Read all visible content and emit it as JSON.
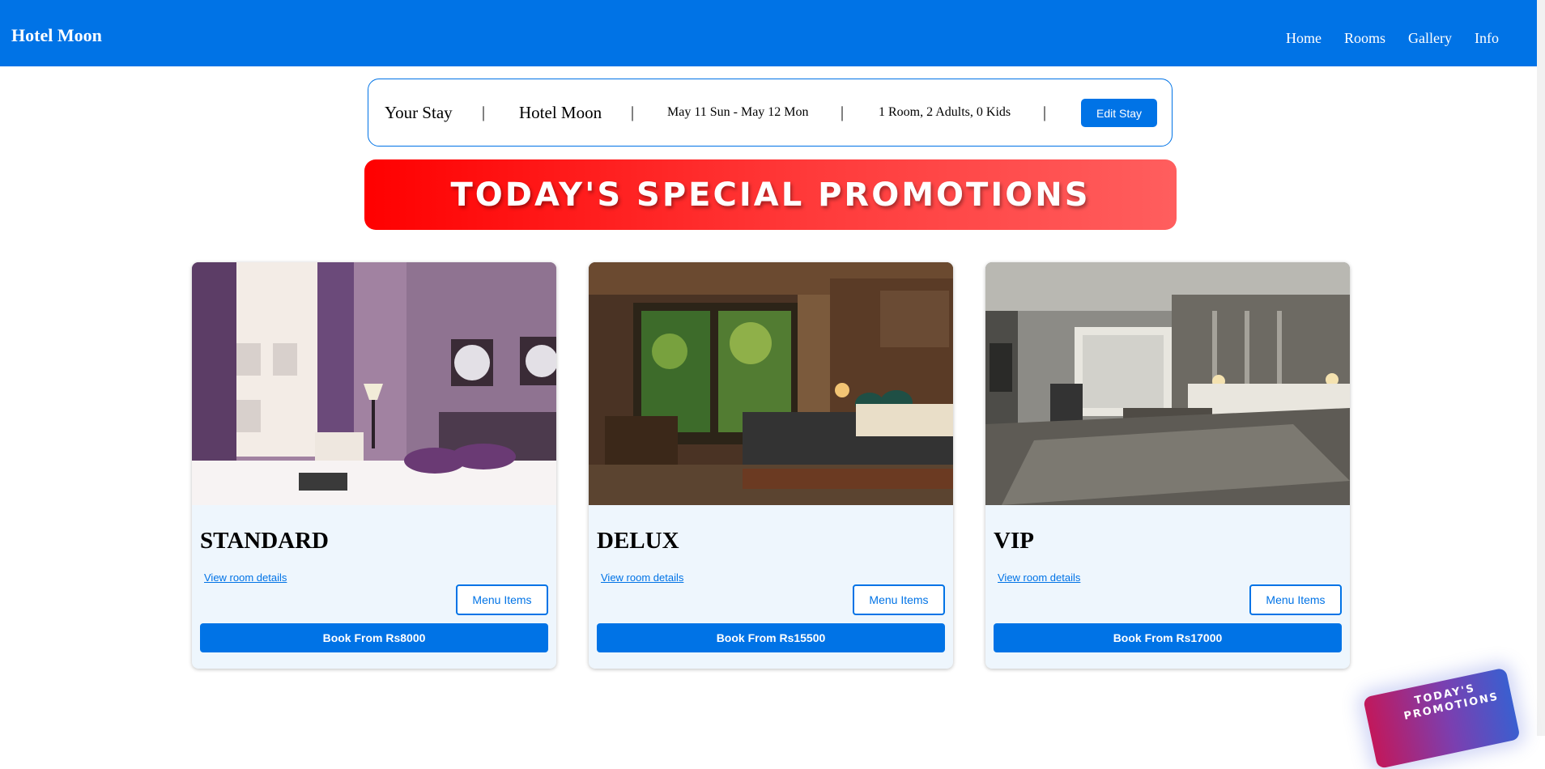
{
  "navbar": {
    "brand": "Hotel Moon",
    "links": [
      "Home",
      "Rooms",
      "Gallery",
      "Info"
    ]
  },
  "stay": {
    "title": "Your Stay",
    "separator": "|",
    "hotel": "Hotel Moon",
    "dates": "May 11 Sun - May 12 Mon",
    "guests": "1 Room, 2 Adults, 0 Kids",
    "edit_label": "Edit Stay"
  },
  "promo": {
    "banner_text": "TODAY'S SPECIAL PROMOTIONS",
    "floating_text": "TODAY'S PROMOTIONS"
  },
  "rooms": [
    {
      "name": "STANDARD",
      "details_link": "View room details",
      "menu_label": "Menu Items",
      "book_label": "Book From Rs8000"
    },
    {
      "name": "DELUX",
      "details_link": "View room details",
      "menu_label": "Menu Items",
      "book_label": "Book From Rs15500"
    },
    {
      "name": "VIP",
      "details_link": "View room details",
      "menu_label": "Menu Items",
      "book_label": "Book From Rs17000"
    }
  ],
  "colors": {
    "primary": "#0073e6",
    "promo_start": "#ff0000",
    "promo_end": "#ff5e5e",
    "card_bg": "#eef6fd"
  }
}
